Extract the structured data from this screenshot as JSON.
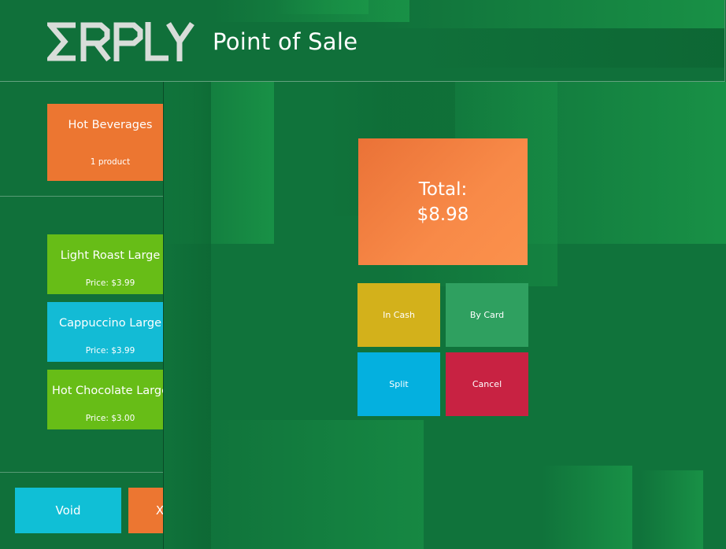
{
  "header": {
    "logo_text": "ERPLY",
    "title": "Point of Sale"
  },
  "category": {
    "title": "Hot Beverages",
    "subtitle": "1 product"
  },
  "products": [
    {
      "name": "Light Roast Large",
      "price": "Price: $3.99",
      "color": "#67bd17"
    },
    {
      "name": "Cappuccino Large",
      "price": "Price: $3.99",
      "color": "#13bbd5"
    },
    {
      "name": "Hot Chocolate Large",
      "price": "Price: $3.00",
      "color": "#67bd17"
    }
  ],
  "bottom_bar": {
    "void_label": "Void",
    "second_label": "X"
  },
  "payment": {
    "total_label": "Total:",
    "total_amount": "$8.98",
    "buttons": {
      "cash": "In Cash",
      "card": "By Card",
      "split": "Split",
      "cancel": "Cancel"
    }
  },
  "colors": {
    "background": "#10703a",
    "orange": "#ec7631",
    "green_tile": "#67bd17",
    "cyan_tile": "#13bbd5",
    "cash": "#d3b11b",
    "card": "#2fa060",
    "split": "#04b0df",
    "cancel": "#c82242"
  }
}
